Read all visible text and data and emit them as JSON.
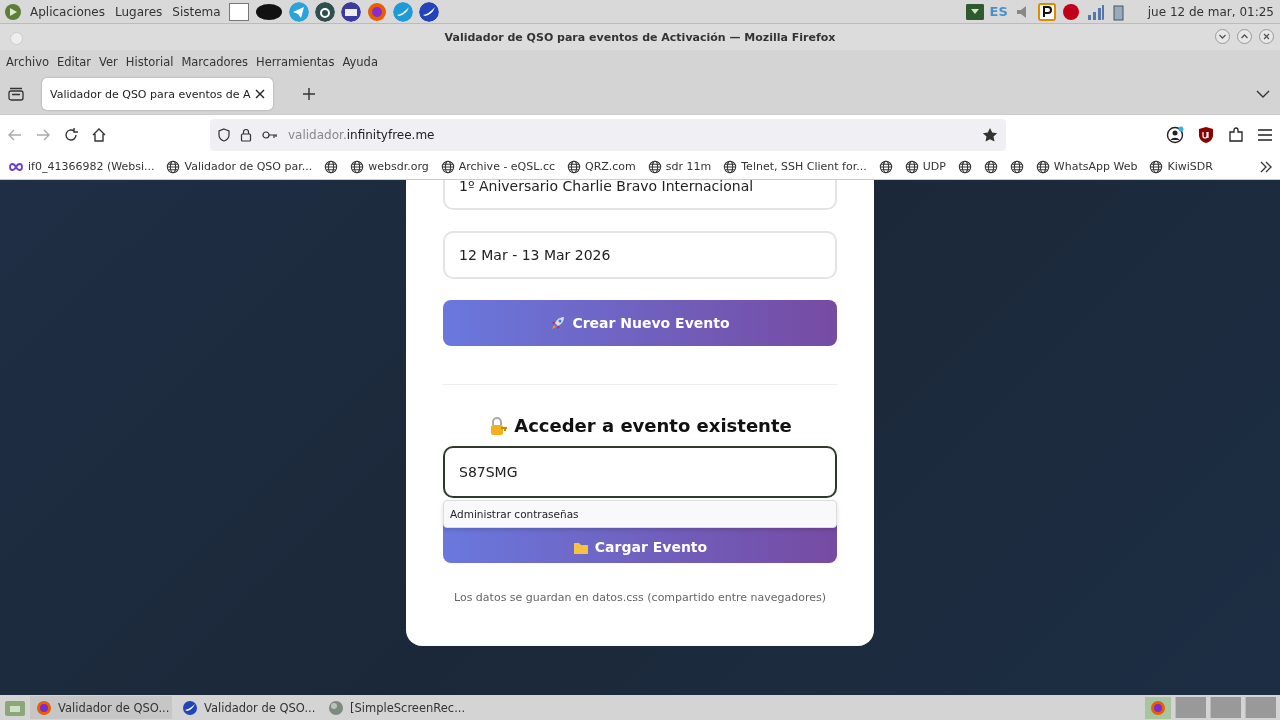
{
  "top_panel": {
    "menus": [
      "Aplicaciones",
      "Lugares",
      "Sistema"
    ],
    "keyboard_layout": "ES",
    "clock": "jue 12 de mar, 01:25"
  },
  "window": {
    "title": "Validador de QSO para eventos de Activación — Mozilla Firefox"
  },
  "menu_bar": [
    "Archivo",
    "Editar",
    "Ver",
    "Historial",
    "Marcadores",
    "Herramientas",
    "Ayuda"
  ],
  "tabs": [
    {
      "label": "Validador de QSO para eventos de A",
      "selected": true
    }
  ],
  "address_bar": {
    "domain_prefix": "validador.",
    "domain": "infinityfree.me"
  },
  "bookmarks": [
    {
      "kind": "infinity",
      "label": "if0_41366982 (Websi..."
    },
    {
      "kind": "globe",
      "label": "Validador de QSO par..."
    },
    {
      "kind": "globe"
    },
    {
      "kind": "globe",
      "label": "websdr.org"
    },
    {
      "kind": "globe",
      "label": "Archive - eQSL.cc"
    },
    {
      "kind": "globe",
      "label": "QRZ.com"
    },
    {
      "kind": "globe",
      "label": "sdr 11m"
    },
    {
      "kind": "globe",
      "label": "Telnet, SSH Client for..."
    },
    {
      "kind": "globe"
    },
    {
      "kind": "globe",
      "label": "UDP"
    },
    {
      "kind": "globe"
    },
    {
      "kind": "globe"
    },
    {
      "kind": "globe"
    },
    {
      "kind": "globe",
      "label": "WhatsApp Web"
    },
    {
      "kind": "globe",
      "label": "KiwiSDR"
    }
  ],
  "card": {
    "event_name": "1º Aniversario Charlie Bravo Internacional",
    "event_dates": "12 Mar - 13 Mar 2026",
    "create_button": "Crear Nuevo Evento",
    "access_heading": "Acceder a evento existente",
    "event_code": "S87SMG",
    "autocomplete_item": "Administrar contraseñas",
    "load_button": "Cargar Evento",
    "footer_note": "Los datos se guardan en datos.css (compartido entre navegadores)"
  },
  "taskbar": [
    {
      "kind": "firefox",
      "label": "Validador de QSO...",
      "selected": true
    },
    {
      "kind": "seamonkey",
      "label": "Validador de QSO...",
      "selected": false
    },
    {
      "kind": "recorder",
      "label": "[SimpleScreenRec...",
      "selected": false
    }
  ]
}
